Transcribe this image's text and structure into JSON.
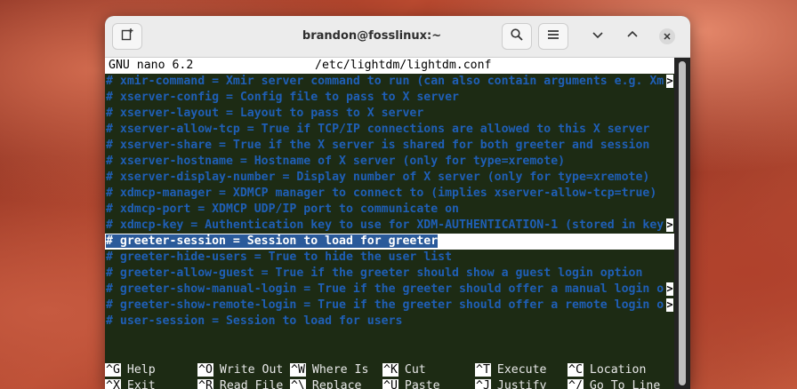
{
  "window": {
    "title": "brandon@fosslinux:~"
  },
  "icons": {
    "new_tab": "new-tab-icon",
    "search": "search-icon",
    "menu": "hamburger-menu-icon",
    "minimize": "chevron-down-icon",
    "maximize": "chevron-up-icon",
    "close": "close-icon"
  },
  "nano": {
    "version": "GNU nano 6.2",
    "filename": "/etc/lightdm/lightdm.conf",
    "overflow_marker": ">",
    "lines": [
      {
        "text": "# xmir-command = Xmir server command to run (can also contain arguments e.g. Xm",
        "overflow": true
      },
      {
        "text": "# xserver-config = Config file to pass to X server",
        "overflow": false
      },
      {
        "text": "# xserver-layout = Layout to pass to X server",
        "overflow": false
      },
      {
        "text": "# xserver-allow-tcp = True if TCP/IP connections are allowed to this X server",
        "overflow": false
      },
      {
        "text": "# xserver-share = True if the X server is shared for both greeter and session",
        "overflow": false
      },
      {
        "text": "# xserver-hostname = Hostname of X server (only for type=xremote)",
        "overflow": false
      },
      {
        "text": "# xserver-display-number = Display number of X server (only for type=xremote)",
        "overflow": false
      },
      {
        "text": "# xdmcp-manager = XDMCP manager to connect to (implies xserver-allow-tcp=true)",
        "overflow": false
      },
      {
        "text": "# xdmcp-port = XDMCP UDP/IP port to communicate on",
        "overflow": false
      },
      {
        "text": "# xdmcp-key = Authentication key to use for XDM-AUTHENTICATION-1 (stored in key",
        "overflow": true
      },
      {
        "text": "# greeter-session = Session to load for greeter",
        "overflow": false,
        "selected": true
      },
      {
        "text": "# greeter-hide-users = True to hide the user list",
        "overflow": false
      },
      {
        "text": "# greeter-allow-guest = True if the greeter should show a guest login option",
        "overflow": false
      },
      {
        "text": "# greeter-show-manual-login = True if the greeter should offer a manual login o",
        "overflow": true
      },
      {
        "text": "# greeter-show-remote-login = True if the greeter should offer a remote login o",
        "overflow": true
      },
      {
        "text": "# user-session = Session to load for users",
        "overflow": false
      }
    ],
    "shortcuts_row1": [
      {
        "key": "^G",
        "label": "Help"
      },
      {
        "key": "^O",
        "label": "Write Out"
      },
      {
        "key": "^W",
        "label": "Where Is"
      },
      {
        "key": "^K",
        "label": "Cut"
      },
      {
        "key": "^T",
        "label": "Execute"
      },
      {
        "key": "^C",
        "label": "Location"
      }
    ],
    "shortcuts_row2": [
      {
        "key": "^X",
        "label": "Exit"
      },
      {
        "key": "^R",
        "label": "Read File"
      },
      {
        "key": "^\\",
        "label": "Replace"
      },
      {
        "key": "^U",
        "label": "Paste"
      },
      {
        "key": "^J",
        "label": "Justify"
      },
      {
        "key": "^/",
        "label": "Go To Line"
      }
    ]
  },
  "colors": {
    "terminal_bg": "#1d2b14",
    "comment_text": "#1f5fb6",
    "selection_bg": "#2a5a9a"
  }
}
